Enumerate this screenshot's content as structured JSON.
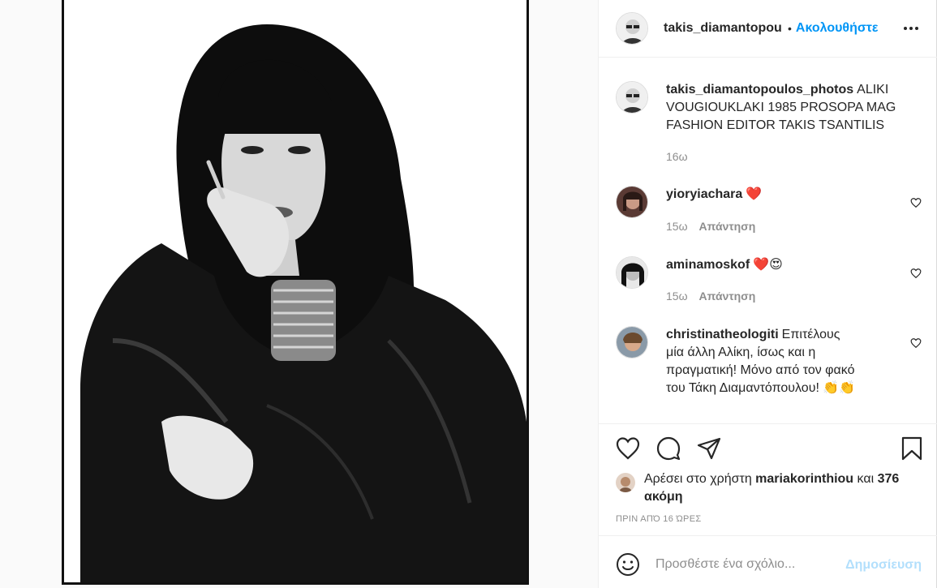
{
  "post": {
    "author": "takis_diamantopoulos_photos",
    "header_username": "takis_diamantopou",
    "follow_label": "Ακολουθήστε",
    "dot": "•",
    "caption": "ALIKI VOUGIOUKLAKI 1985 PROSOPA MAG FASHION EDITOR TAKIS TSANTILIS",
    "caption_time": "16ω"
  },
  "comments": [
    {
      "username": "yioryiachara",
      "text": "",
      "emoji": "❤️",
      "time": "15ω",
      "reply": "Απάντηση"
    },
    {
      "username": "aminamoskof",
      "text": "",
      "emoji": "❤️😍",
      "time": "15ω",
      "reply": "Απάντηση"
    },
    {
      "username": "christinatheologiti",
      "text": "Επιτέλους μία άλλη Αλίκη, ίσως και η πραγματική! Μόνο από τον φακό του Τάκη Διαμαντόπουλου!",
      "emoji": "👏👏",
      "time": "",
      "reply": ""
    }
  ],
  "likes": {
    "prefix": "Αρέσει στο χρήστη",
    "user": "mariakorinthiou",
    "and": "και",
    "rest": "376 ακόμη"
  },
  "timestamp": "ΠΡΙΝ ΑΠΌ 16 ΏΡΕΣ",
  "composer": {
    "placeholder": "Προσθέστε ένα σχόλιο...",
    "post_label": "Δημοσίευση"
  },
  "colors": {
    "accent": "#0095f6",
    "heart_red": "#ed4956",
    "post_disabled": "#b2dffc"
  }
}
